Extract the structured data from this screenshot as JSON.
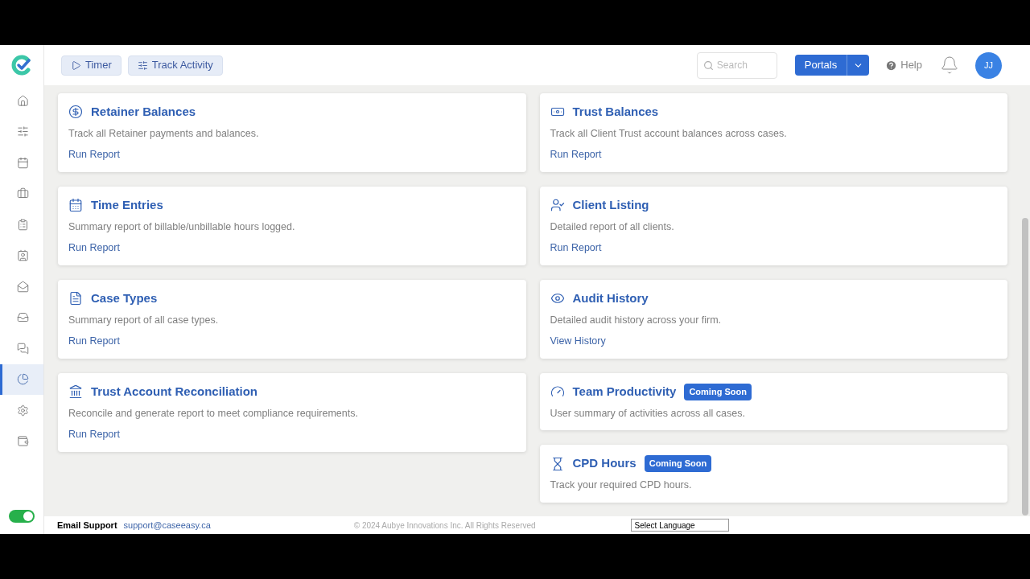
{
  "header": {
    "buttons": [
      {
        "kind": "play",
        "label": "Timer"
      },
      {
        "kind": "sliders",
        "label": "Track Activity"
      }
    ],
    "search": {
      "placeholder": "Search"
    },
    "portals": "Portals",
    "help": "Help",
    "avatar": "JJ"
  },
  "sidebar": {
    "items": [
      {
        "kind": "home",
        "selected": false
      },
      {
        "kind": "sliders",
        "selected": false
      },
      {
        "kind": "calendar",
        "selected": false
      },
      {
        "kind": "briefcase",
        "selected": false
      },
      {
        "kind": "clipboard",
        "selected": false
      },
      {
        "kind": "contact",
        "selected": false
      },
      {
        "kind": "mail",
        "selected": false
      },
      {
        "kind": "inbox",
        "selected": false
      },
      {
        "kind": "chat",
        "selected": false
      },
      {
        "kind": "pie",
        "selected": true
      },
      {
        "kind": "settings",
        "selected": false
      },
      {
        "kind": "wallet",
        "selected": false
      }
    ],
    "toggle": {
      "on": true
    }
  },
  "columns": [
    [
      {
        "kind": "money",
        "title": "Retainer Balances",
        "description": "Track all Retainer payments and balances.",
        "link": "Run Report"
      },
      {
        "kind": "calendar",
        "title": "Time Entries",
        "description": "Summary report of billable/unbillable hours logged.",
        "link": "Run Report"
      },
      {
        "kind": "document",
        "title": "Case Types",
        "description": "Summary report of all case types.",
        "link": "Run Report"
      },
      {
        "kind": "bank",
        "title": "Trust Account Reconciliation",
        "description": "Reconcile and generate report to meet compliance requirements.",
        "link": "Run Report"
      }
    ],
    [
      {
        "kind": "cash",
        "title": "Trust Balances",
        "description": "Track all Client Trust account balances across cases.",
        "link": "Run Report"
      },
      {
        "kind": "user-check",
        "title": "Client Listing",
        "description": "Detailed report of all clients.",
        "link": "Run Report"
      },
      {
        "kind": "eye",
        "title": "Audit History",
        "description": "Detailed audit history across your firm.",
        "link": "View History"
      },
      {
        "kind": "gauge",
        "title": "Team Productivity",
        "badge": "Coming Soon",
        "description": "User summary of activities across all cases."
      },
      {
        "kind": "hourglass",
        "title": "CPD Hours",
        "badge": "Coming Soon",
        "description": "Track your required CPD hours."
      }
    ]
  ],
  "footer": {
    "label": "Email Support",
    "email": "support@caseeasy.ca",
    "copyright": "© 2024 Aubye Innovations Inc. All Rights Reserved",
    "language": "Select Language"
  }
}
